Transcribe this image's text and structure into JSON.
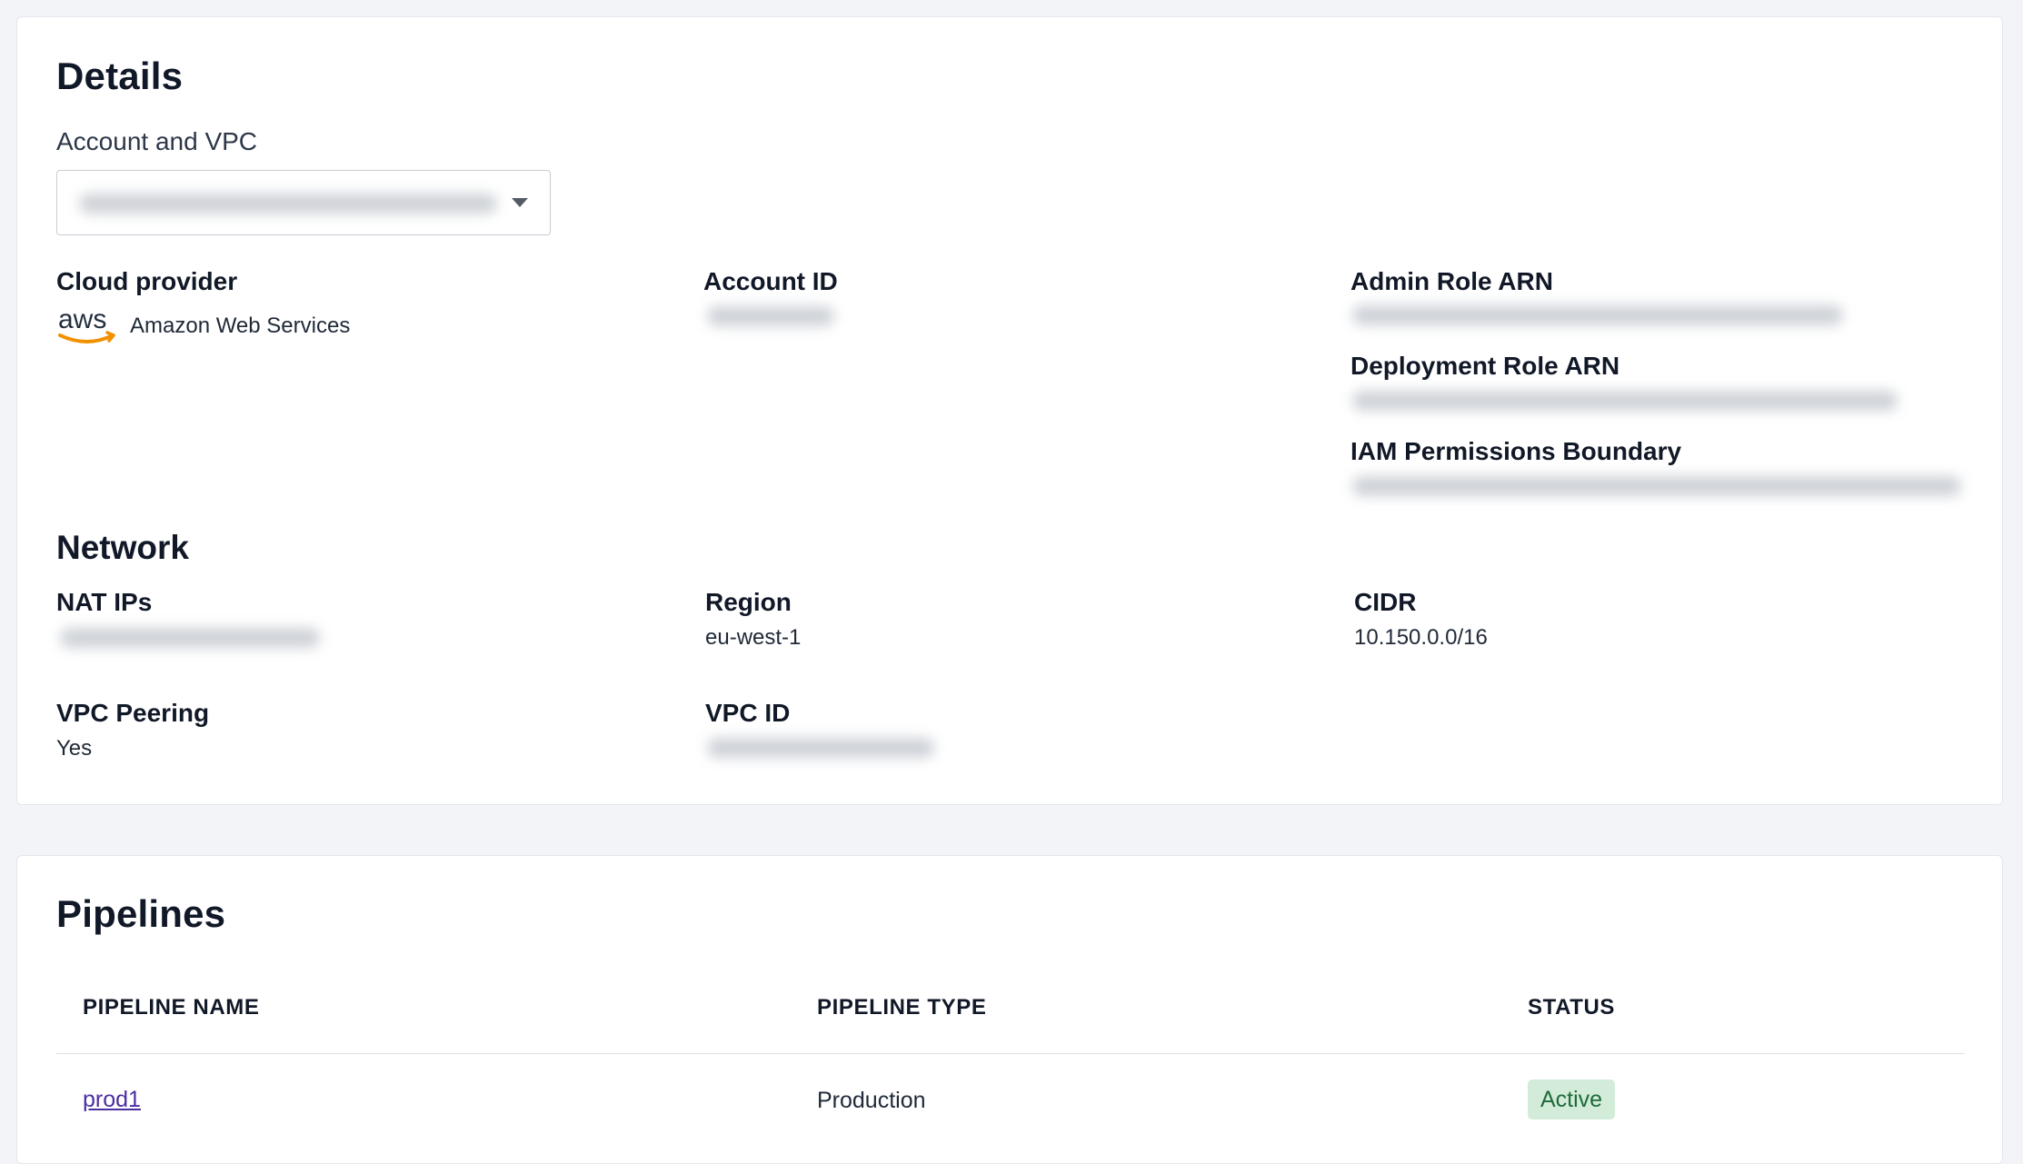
{
  "details": {
    "title": "Details",
    "account_vpc_label": "Account and VPC",
    "account_vpc_value": "",
    "cloud_provider": {
      "label": "Cloud provider",
      "logo": "aws",
      "value": "Amazon Web Services"
    },
    "account_id": {
      "label": "Account ID",
      "value": ""
    },
    "admin_role_arn": {
      "label": "Admin Role ARN",
      "value": ""
    },
    "deployment_role_arn": {
      "label": "Deployment Role ARN",
      "value": ""
    },
    "iam_permissions_boundary": {
      "label": "IAM Permissions Boundary",
      "value": ""
    }
  },
  "network": {
    "title": "Network",
    "nat_ips": {
      "label": "NAT IPs",
      "value": ""
    },
    "region": {
      "label": "Region",
      "value": "eu-west-1"
    },
    "cidr": {
      "label": "CIDR",
      "value": "10.150.0.0/16"
    },
    "vpc_peering": {
      "label": "VPC Peering",
      "value": "Yes"
    },
    "vpc_id": {
      "label": "VPC ID",
      "value": ""
    }
  },
  "pipelines": {
    "title": "Pipelines",
    "columns": [
      "PIPELINE NAME",
      "PIPELINE TYPE",
      "STATUS"
    ],
    "rows": [
      {
        "name": "prod1",
        "type": "Production",
        "status": "Active"
      }
    ]
  },
  "colors": {
    "link": "#4c2ea3",
    "badge_bg": "#d3ecd9",
    "badge_text": "#1e6b3a",
    "aws_orange": "#f29100"
  }
}
